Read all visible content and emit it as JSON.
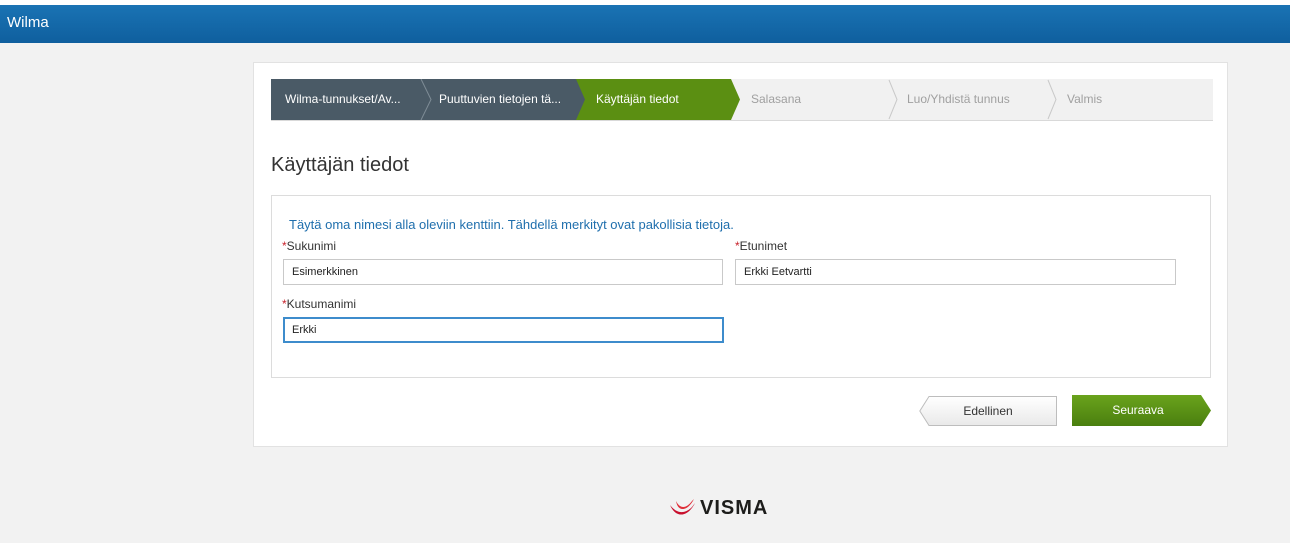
{
  "app": {
    "title": "Wilma"
  },
  "wizard": {
    "steps": [
      {
        "label": "Wilma-tunnukset/Av...",
        "state": "done"
      },
      {
        "label": "Puuttuvien tietojen tä...",
        "state": "done"
      },
      {
        "label": "Käyttäjän tiedot",
        "state": "active"
      },
      {
        "label": "Salasana",
        "state": "todo"
      },
      {
        "label": "Luo/Yhdistä tunnus",
        "state": "todo"
      },
      {
        "label": "Valmis",
        "state": "todo"
      }
    ]
  },
  "page": {
    "heading": "Käyttäjän tiedot"
  },
  "form": {
    "intro": "Täytä oma nimesi alla oleviin kenttiin. Tähdellä merkityt ovat pakollisia tietoja.",
    "required_mark": "*",
    "lastname": {
      "label": "Sukunimi",
      "value": "Esimerkkinen"
    },
    "firstnames": {
      "label": "Etunimet",
      "value": "Erkki Eetvartti"
    },
    "nickname": {
      "label": "Kutsumanimi",
      "value": "Erkki"
    }
  },
  "buttons": {
    "previous": "Edellinen",
    "next": "Seuraava"
  },
  "footer": {
    "logo_text": "VISMA"
  },
  "colors": {
    "header": "#1a73b4",
    "active_step": "#5b8f12",
    "done_step": "#4a5a66",
    "brand_logo": "#c8102e"
  }
}
